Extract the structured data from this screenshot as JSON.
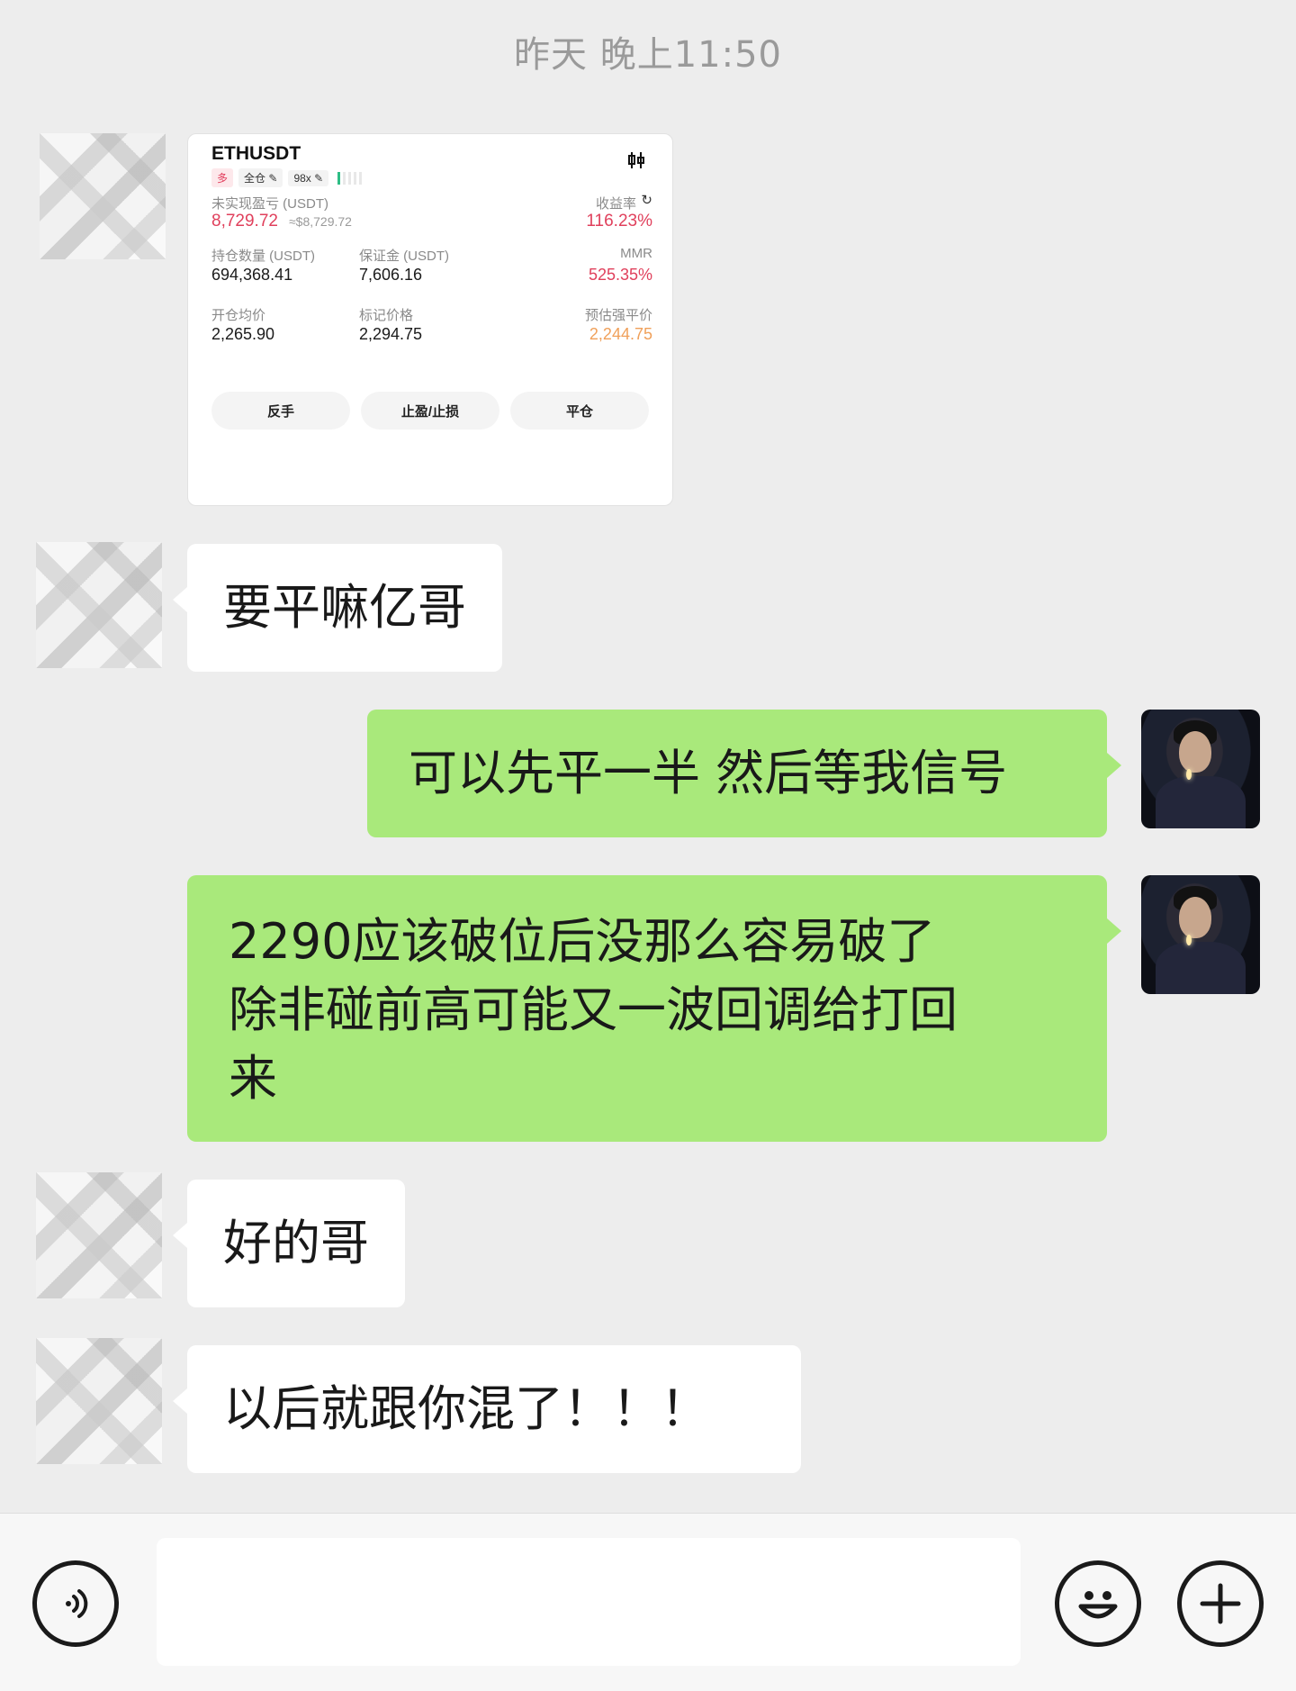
{
  "timestamp": "昨天 晚上11:50",
  "card": {
    "symbol": "ETHUSDT",
    "tag_long": "多",
    "tag_margin": "全仓",
    "tag_leverage": "98x",
    "unrealized_label": "未实现盈亏 (USDT)",
    "unrealized_value": "8,729.72",
    "unrealized_usd": "≈$8,729.72",
    "roi_label": "收益率",
    "roi_value": "116.23%",
    "position_label": "持仓数量 (USDT)",
    "position_value": "694,368.41",
    "margin_label": "保证金 (USDT)",
    "margin_value": "7,606.16",
    "mmr_label": "MMR",
    "mmr_value": "525.35%",
    "entry_label": "开仓均价",
    "entry_value": "2,265.90",
    "mark_label": "标记价格",
    "mark_value": "2,294.75",
    "liq_label": "预估强平价",
    "liq_value": "2,244.75",
    "btn_reverse": "反手",
    "btn_tpsl": "止盈/止损",
    "btn_close": "平仓"
  },
  "messages": {
    "m1": "要平嘛亿哥",
    "m2": "可以先平一半 然后等我信号",
    "m3_line1": "2290应该破位后没那么容易破了",
    "m3_line2": "除非碰前高可能又一波回调给打回",
    "m3_line3": "来",
    "m4": "好的哥",
    "m5": "以后就跟你混了！！！"
  },
  "icons": {
    "voice": "voice-icon",
    "emoji": "emoji-icon",
    "plus": "plus-icon",
    "refresh": "refresh-icon",
    "candles": "candlestick-icon",
    "edit": "edit-icon"
  }
}
